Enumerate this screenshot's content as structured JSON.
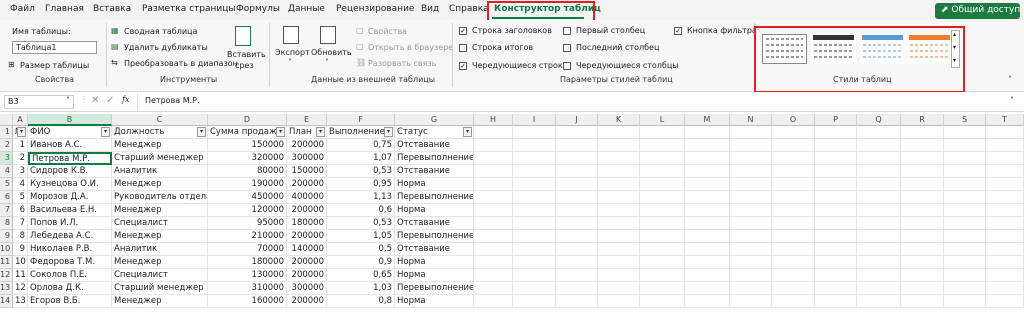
{
  "tabs": [
    "Файл",
    "Главная",
    "Вставка",
    "Разметка страницы",
    "Формулы",
    "Данные",
    "Рецензирование",
    "Вид",
    "Справка",
    "Конструктор таблиц"
  ],
  "share_label": "Общий доступ",
  "ribbon": {
    "properties": {
      "name_label": "Имя таблицы:",
      "name_value": "Таблица1",
      "resize": "Размер таблицы",
      "group": "Свойства"
    },
    "tools": {
      "pivot": "Сводная таблица",
      "dedupe": "Удалить дубликаты",
      "convert": "Преобразовать в диапазон",
      "slicer_line1": "Вставить",
      "slicer_line2": "срез",
      "group": "Инструменты"
    },
    "external": {
      "export": "Экспорт",
      "refresh": "Обновить",
      "properties": "Свойства",
      "open_browser": "Открыть в браузере",
      "unlink": "Разорвать связь",
      "group": "Данные из внешней таблицы"
    },
    "style_options": {
      "header_row": "Строка заголовков",
      "total_row": "Строка итогов",
      "banded_rows": "Чередующиеся строки",
      "first_col": "Первый столбец",
      "last_col": "Последний столбец",
      "banded_cols": "Чередующиеся столбцы",
      "filter_button": "Кнопка фильтра",
      "group": "Параметры стилей таблиц",
      "checked": {
        "header_row": true,
        "total_row": false,
        "banded_rows": true,
        "first_col": false,
        "last_col": false,
        "banded_cols": false,
        "filter_button": true
      }
    },
    "styles": {
      "group": "Стили таблиц",
      "swatch_colors": [
        "#333333",
        "#333333",
        "#5b9bd5",
        "#ed7d31"
      ]
    }
  },
  "formula_bar": {
    "name_box": "B3",
    "fx": "fx",
    "content": "Петрова М.Р."
  },
  "columns": [
    "A",
    "B",
    "C",
    "D",
    "E",
    "F",
    "G",
    "H",
    "I",
    "J",
    "K",
    "L",
    "M",
    "N",
    "O",
    "P",
    "Q",
    "R",
    "S",
    "T"
  ],
  "headers": [
    "№",
    "ФИО",
    "Должность",
    "Сумма продаж",
    "План",
    "Выполнение",
    "Статус"
  ],
  "rows": [
    [
      "1",
      "Иванов А.С.",
      "Менеджер",
      "150000",
      "200000",
      "0,75",
      "Отставание"
    ],
    [
      "2",
      "Петрова М.Р.",
      "Старший менеджер",
      "320000",
      "300000",
      "1,07",
      "Перевыполнение"
    ],
    [
      "3",
      "Сидоров К.В.",
      "Аналитик",
      "80000",
      "150000",
      "0,53",
      "Отставание"
    ],
    [
      "4",
      "Кузнецова О.И.",
      "Менеджер",
      "190000",
      "200000",
      "0,95",
      "Норма"
    ],
    [
      "5",
      "Морозов Д.А.",
      "Руководитель отдела",
      "450000",
      "400000",
      "1,13",
      "Перевыполнение"
    ],
    [
      "6",
      "Васильева Е.Н.",
      "Менеджер",
      "120000",
      "200000",
      "0,6",
      "Норма"
    ],
    [
      "7",
      "Попов И.Л.",
      "Специалист",
      "95000",
      "180000",
      "0,53",
      "Отставание"
    ],
    [
      "8",
      "Лебедева А.С.",
      "Менеджер",
      "210000",
      "200000",
      "1,05",
      "Перевыполнение"
    ],
    [
      "9",
      "Николаев Р.В.",
      "Аналитик",
      "70000",
      "140000",
      "0,5",
      "Отставание"
    ],
    [
      "10",
      "Федорова Т.М.",
      "Менеджер",
      "180000",
      "200000",
      "0,9",
      "Норма"
    ],
    [
      "11",
      "Соколов П.Е.",
      "Специалист",
      "130000",
      "200000",
      "0,65",
      "Норма"
    ],
    [
      "12",
      "Орлова Д.К.",
      "Старший менеджер",
      "310000",
      "300000",
      "1,03",
      "Перевыполнение"
    ],
    [
      "13",
      "Егоров В.Б.",
      "Менеджер",
      "160000",
      "200000",
      "0,8",
      "Норма"
    ]
  ],
  "row_numbers": [
    "1",
    "2",
    "3",
    "4",
    "5",
    "6",
    "7",
    "8",
    "9",
    "10",
    "11",
    "12",
    "13",
    "14"
  ],
  "accent": "#107c41",
  "highlight": "#e02020"
}
